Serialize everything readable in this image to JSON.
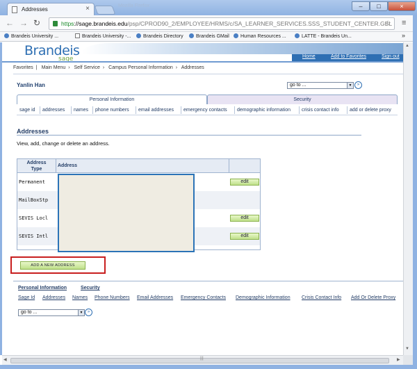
{
  "browser": {
    "tab_title": "Addresses",
    "ghost_tab": "Mozilla Firefox",
    "url_scheme": "https",
    "url_host": "://sage.brandeis.edu",
    "url_path": "/psp/CPROD90_2/EMPLOYEE/HRMS/c/SA_LEARNER_SERVICES.SSS_STUDENT_CENTER.GBL",
    "bookmarks": [
      "Brandeis University ...",
      "Brandeis University -...",
      "Brandeis Directory",
      "Brandeis GMail",
      "Human Resources ...",
      "LATTE - Brandeis Un..."
    ],
    "more": "»"
  },
  "header": {
    "logo_brand": "Brandeis",
    "logo_sub": "sage",
    "links": [
      "Home",
      "Add to Favorites",
      "Sign out"
    ]
  },
  "breadcrumb": [
    "Favorites",
    "Main Menu",
    "Self Service",
    "Campus Personal Information",
    "Addresses"
  ],
  "user": {
    "name": "Yanlin Han"
  },
  "goto": {
    "value": "go to ...",
    "go": "»"
  },
  "tabs": [
    "Personal Information",
    "Security"
  ],
  "subnav": [
    "sage id",
    "addresses",
    "names",
    "phone numbers",
    "email addresses",
    "emergency contacts",
    "demographic information",
    "crisis contact info",
    "add or delete proxy"
  ],
  "main": {
    "heading": "Addresses",
    "intro": "View, add, change or delete an address.",
    "table": {
      "col_type": "Address Type",
      "col_type_1": "Address",
      "col_type_2": "Type",
      "col_address": "Address",
      "rows": [
        {
          "type": "Permanent",
          "edit": "edit"
        },
        {
          "type": "MailBoxStp",
          "edit": ""
        },
        {
          "type": "SEVIS Locl",
          "edit": "edit"
        },
        {
          "type": "SEVIS Intl",
          "edit": "edit"
        }
      ]
    },
    "add_button": "ADD A NEW ADDRESS"
  },
  "footer": {
    "tabs": [
      "Personal Information",
      "Security"
    ],
    "links": [
      "Sage Id",
      "Addresses",
      "Names",
      "Phone Numbers",
      "Email Addresses",
      "Emergency Contacts",
      "Demographic Information",
      "Crisis Contact Info",
      "Add Or Delete Proxy"
    ],
    "goto": "go to ..."
  },
  "colors": {
    "accent": "#2e6fb3",
    "highlight": "#c81e1e",
    "button": "#bfe08a"
  }
}
